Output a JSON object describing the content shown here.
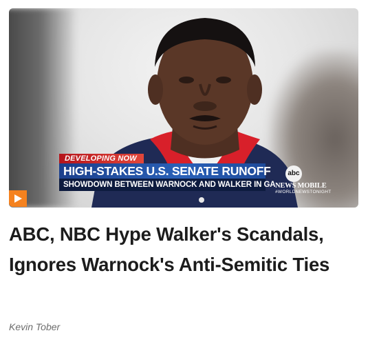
{
  "video": {
    "tag": "DEVELOPING NOW",
    "headline": "HIGH-STAKES U.S. SENATE RUNOFF",
    "subheadline": "SHOWDOWN BETWEEN WARNOCK AND WALKER IN GA",
    "logo_text": "abc",
    "network": "NEWS MOBILE",
    "hashtag": "#WORLDNEWSTONIGHT",
    "play_icon": "play-icon",
    "accent": "#f5821f"
  },
  "article": {
    "title": "ABC, NBC Hype Walker's Scandals, Ignores Warnock's Anti-Semitic Ties",
    "author": "Kevin Tober"
  }
}
